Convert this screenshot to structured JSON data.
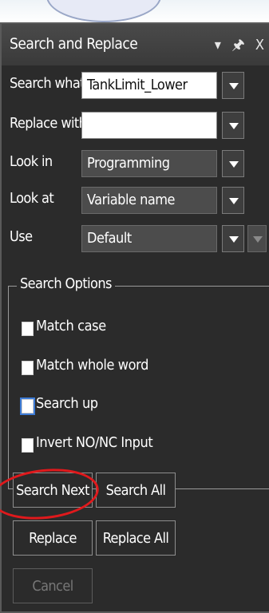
{
  "title": "Search and Replace",
  "title_icons": [
    "dropdown-arrow-icon",
    "pin-icon",
    "close-icon"
  ],
  "fields": {
    "search_what": {
      "label": "Search what",
      "value": "TankLimit_Lower"
    },
    "replace_with": {
      "label": "Replace with",
      "value": ""
    },
    "look_in": {
      "label": "Look in",
      "value": "Programming"
    },
    "look_at": {
      "label": "Look at",
      "value": "Variable name"
    },
    "use": {
      "label": "Use",
      "value": "Default"
    }
  },
  "search_options": {
    "title": "Search Options",
    "match_case": "Match case",
    "match_whole_word": "Match whole word",
    "search_up": "Search up",
    "invert_no_nc": "Invert NO/NC Input"
  },
  "buttons": {
    "search_next": "Search Next",
    "search_all": "Search All",
    "replace": "Replace",
    "replace_all": "Replace All",
    "cancel": "Cancel"
  },
  "colors": {
    "panel_bg": "#2b2b2b",
    "annotation_red": "#e0191c",
    "checkbox_focus": "#3d7bd6"
  }
}
